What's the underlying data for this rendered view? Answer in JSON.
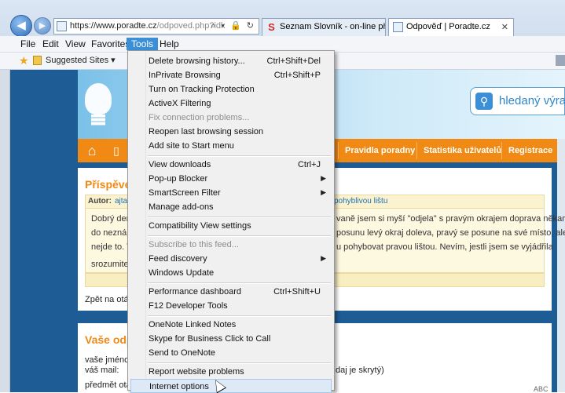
{
  "browser": {
    "url_host": "https://www.poradte.cz",
    "url_path": "/odpoved.php?idk",
    "address_controls": "⌕ ▾ 🔒 ↻",
    "tabs": [
      {
        "label": "Seznam Slovník - on-line překl...",
        "icon_letter": "S",
        "icon_color": "#d62828"
      },
      {
        "label": "Odpověď | Poradte.cz",
        "close": "✕"
      }
    ],
    "menu": [
      "File",
      "Edit",
      "View",
      "Favorites",
      "Tools",
      "Help"
    ],
    "favorites_bar": {
      "suggested_sites": "Suggested Sites ▾"
    }
  },
  "tools_menu": {
    "items": [
      {
        "label": "Delete browsing history...",
        "shortcut": "Ctrl+Shift+Del"
      },
      {
        "label": "InPrivate Browsing",
        "shortcut": "Ctrl+Shift+P"
      },
      {
        "label": "Turn on Tracking Protection",
        "shortcut": ""
      },
      {
        "label": "ActiveX Filtering",
        "shortcut": ""
      },
      {
        "label": "Fix connection problems...",
        "shortcut": ""
      },
      {
        "label": "Reopen last browsing session",
        "shortcut": ""
      },
      {
        "label": "Add site to Start menu",
        "shortcut": ""
      },
      {
        "label": "View downloads",
        "shortcut": "Ctrl+J"
      },
      {
        "label": "Pop-up Blocker",
        "shortcut": ""
      },
      {
        "label": "SmartScreen Filter",
        "shortcut": ""
      },
      {
        "label": "Manage add-ons",
        "shortcut": ""
      },
      {
        "label": "Compatibility View settings",
        "shortcut": ""
      },
      {
        "label": "Subscribe to this feed...",
        "shortcut": ""
      },
      {
        "label": "Feed discovery",
        "shortcut": ""
      },
      {
        "label": "Windows Update",
        "shortcut": ""
      },
      {
        "label": "Performance dashboard",
        "shortcut": "Ctrl+Shift+U"
      },
      {
        "label": "F12 Developer Tools",
        "shortcut": ""
      },
      {
        "label": "OneNote Linked Notes",
        "shortcut": ""
      },
      {
        "label": "Skype for Business Click to Call",
        "shortcut": ""
      },
      {
        "label": "Send to OneNote",
        "shortcut": ""
      },
      {
        "label": "Report website problems",
        "shortcut": ""
      },
      {
        "label": "Internet options",
        "shortcut": ""
      }
    ],
    "submenu_arrow": "›"
  },
  "page": {
    "search_placeholder": "hledaný výra",
    "nav_links": [
      "Pravidla poradny",
      "Statistika uživatelů",
      "Registrace"
    ],
    "post_title": "Příspěve",
    "meta_author_label": "Autor:",
    "meta_author_value": "ajtac",
    "meta_topic_tail": "pohyblivou lištu",
    "post_lines": [
      "Dobrý den,",
      "vaně jsem si myší \"odjela\" s pravým okrajem doprava někam",
      "do neznám",
      "posunu levý okraj doleva, pravý se posune na své místo, ale",
      "nejde to. T",
      "u pohybovat pravou lištou. Nevím, jestli jsem se vyjádřila",
      "srozumiteln"
    ],
    "back_link": "Zpět na otáz",
    "reply_title": "Vaše odp",
    "form_labels": [
      "vaše jméno:",
      "váš mail:",
      "předmět otáz"
    ],
    "form_tail": "daj je skrytý)",
    "form_tiny": "ABC"
  }
}
